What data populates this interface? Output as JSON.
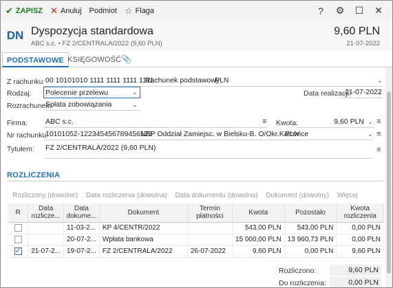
{
  "toolbar": {
    "save": "ZAPISZ",
    "cancel": "Anuluj",
    "subject": "Podmiot",
    "flag": "Flaga",
    "help": "?",
    "settings": "⚙",
    "maximize": "☐",
    "close": "✕"
  },
  "header": {
    "badge": "DN",
    "title": "Dyspozycja standardowa",
    "subtitle": "ABC s.c. • FZ 2/CENTRALA/2022 (9,60 PLN)",
    "amount": "9,60 PLN",
    "date": "21-07-2022"
  },
  "tabs": [
    "PODSTAWOWE",
    "KSIĘGOWOŚĆ"
  ],
  "form": {
    "z_rachunku_label": "Z rachunku:",
    "z_rachunku_number": "00 10101010 1111 1111 1111 1111",
    "z_rachunku_name": "Rachunek podstawowy",
    "z_rachunku_currency": "PLN",
    "rodzaj_label": "Rodzaj:",
    "rodzaj_value": "Polecenie przelewu",
    "data_realizacji_label": "Data realizacji:",
    "data_realizacji_value": "21-07-2022",
    "rozrachunek_label": "Rozrachunek:",
    "rozrachunek_value": "Spłata zobowiązania",
    "firma_label": "Firma:",
    "firma_value": "ABC s.c.",
    "kwota_label": "Kwota:",
    "kwota_value": "9,60 PLN",
    "nr_rachunku_label": "Nr rachunku:",
    "nr_rachunku_value": "10101052-122345456789456123",
    "bank_name": "NBP Oddział Zamiejsc. w Bielsku-B.  O/Okr.Katowice",
    "nr_rachunku_currency": "PLN",
    "tytulem_label": "Tytułem:",
    "tytulem_value": "FZ 2/CENTRALA/2022 (9,60 PLN)"
  },
  "rozliczenia": {
    "title": "ROZLICZENIA",
    "filters": [
      "Rozliczony (dowolne)",
      "Data rozliczenia (dowolna)",
      "Data dokumentu (dowolna)",
      "Dokument (dowolny)",
      "Więcej"
    ],
    "columns": [
      "R",
      "Data rozlicze...",
      "Data dokume...",
      "Dokument",
      "Termin płatności",
      "Kwota",
      "Pozostało",
      "Kwota rozliczenia"
    ],
    "rows": [
      {
        "checked": false,
        "data_rozl": "",
        "data_dok": "11-03-2...",
        "dokument": "KP 4/CENTR/2022",
        "termin": "",
        "kwota": "543,00 PLN",
        "pozostalo": "543,00 PLN",
        "kwota_rozl": "0,00 PLN"
      },
      {
        "checked": false,
        "data_rozl": "",
        "data_dok": "20-07-2...",
        "dokument": "Wpłata bankowa",
        "termin": "",
        "kwota": "15 000,00 PLN",
        "pozostalo": "13 960,73 PLN",
        "kwota_rozl": "0,00 PLN"
      },
      {
        "checked": true,
        "data_rozl": "21-07-2...",
        "data_dok": "19-07-2...",
        "dokument": "FZ 2/CENTRALA/2022",
        "termin": "26-07-2022",
        "kwota": "9,60 PLN",
        "pozostalo": "0,00 PLN",
        "kwota_rozl": "9,60 PLN"
      }
    ],
    "rozliczono_label": "Rozliczono:",
    "rozliczono_value": "9,60 PLN",
    "do_rozliczenia_label": "Do rozliczenia:",
    "do_rozliczenia_value": "0,00 PLN"
  }
}
